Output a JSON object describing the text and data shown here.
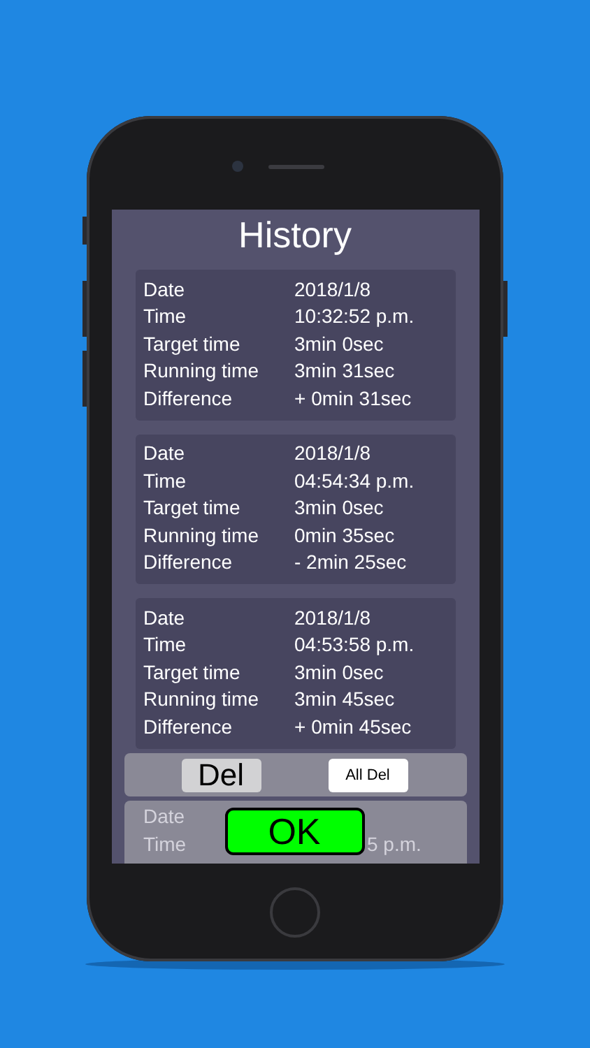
{
  "title": "History",
  "records": [
    {
      "rows": [
        {
          "label": "Date",
          "value": "2018/1/8"
        },
        {
          "label": "Time",
          "value": "10:32:52 p.m."
        },
        {
          "label": "Target time",
          "value": "3min 0sec"
        },
        {
          "label": "Running time",
          "value": "3min 31sec"
        },
        {
          "label": "Difference",
          "value": "+ 0min 31sec"
        }
      ]
    },
    {
      "rows": [
        {
          "label": "Date",
          "value": "2018/1/8"
        },
        {
          "label": "Time",
          "value": "04:54:34 p.m."
        },
        {
          "label": "Target time",
          "value": "3min 0sec"
        },
        {
          "label": "Running time",
          "value": "0min 35sec"
        },
        {
          "label": "Difference",
          "value": "- 2min 25sec"
        }
      ]
    },
    {
      "rows": [
        {
          "label": "Date",
          "value": "2018/1/8"
        },
        {
          "label": "Time",
          "value": "04:53:58 p.m."
        },
        {
          "label": "Target time",
          "value": "3min 0sec"
        },
        {
          "label": "Running time",
          "value": "3min 45sec"
        },
        {
          "label": "Difference",
          "value": "+ 0min 45sec"
        }
      ]
    }
  ],
  "last_record": {
    "rows": [
      {
        "label": "Date"
      },
      {
        "label": "Time",
        "value": "5 p.m."
      }
    ]
  },
  "del_button": "Del",
  "all_del_button": "All Del",
  "ok_button": "OK"
}
